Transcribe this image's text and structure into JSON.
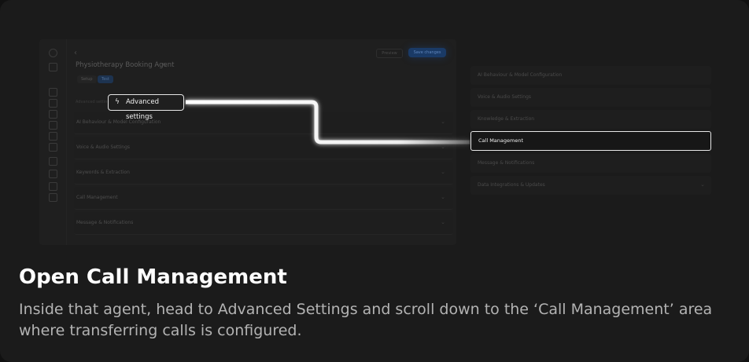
{
  "app": {
    "agent_title": "Physiotherapy Booking Agent",
    "tabs": [
      "Setup",
      "Test"
    ],
    "header_buttons": [
      "Preview",
      "Save changes"
    ],
    "advanced_label": "Advanced settings",
    "sections": [
      "AI Behaviour & Model Configuration",
      "Voice & Audio Settings",
      "Keywords & Extraction",
      "Call Management",
      "Message & Notifications"
    ]
  },
  "right_panel": {
    "items": [
      "AI Behaviour & Model Configuration",
      "Voice & Audio Settings",
      "Knowledge & Extraction",
      "Call Management",
      "Message & Notifications",
      "Data Integrations & Updates"
    ],
    "active_item": "Call Management"
  },
  "caption": {
    "title": "Open Call Management",
    "description": "Inside that agent, head to Advanced Settings and scroll down to the ‘Call Management’ area where transferring calls is configured."
  },
  "icons": {
    "bolt": "lightning-bolt-icon",
    "chevron": "chevron-down-icon",
    "back": "chevron-left-icon",
    "edit": "pencil-icon"
  }
}
